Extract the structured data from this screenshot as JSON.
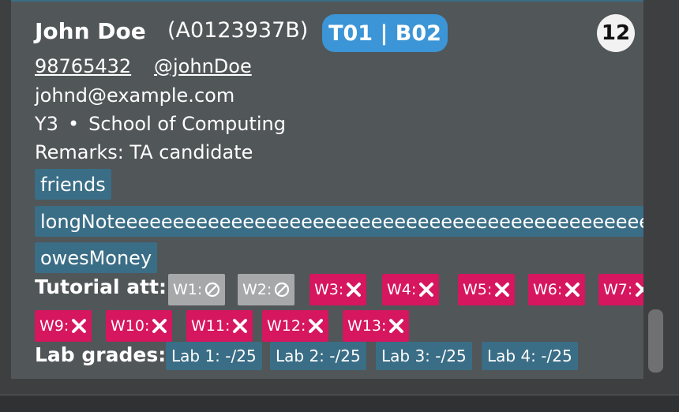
{
  "person": {
    "name": "John Doe",
    "student_id": "(A0123937B)",
    "group": "T01 | B02",
    "index": "12",
    "phone": "98765432",
    "telegram": "@johnDoe",
    "email": "johnd@example.com",
    "year": "Y3",
    "separator": "•",
    "faculty": "School of Computing",
    "remarks": "Remarks: TA candidate"
  },
  "tags": [
    "friends",
    "longNoteeeeeeeeeeeeeeeeeeeeeeeeeeeeeeeeeeeeeeeeeeeeeeeeeeeeeeee",
    "owesMoney"
  ],
  "attendance": {
    "label": "Tutorial att:",
    "weeks": [
      {
        "label": "W1:",
        "status": "not-applicable"
      },
      {
        "label": "W2:",
        "status": "not-applicable"
      },
      {
        "label": "W3:",
        "status": "absent"
      },
      {
        "label": "W4:",
        "status": "absent"
      },
      {
        "label": "W5:",
        "status": "absent"
      },
      {
        "label": "W6:",
        "status": "absent"
      },
      {
        "label": "W7:",
        "status": "absent"
      },
      {
        "label": "W9:",
        "status": "absent"
      },
      {
        "label": "W10:",
        "status": "absent"
      },
      {
        "label": "W11:",
        "status": "absent"
      },
      {
        "label": "W12:",
        "status": "absent"
      },
      {
        "label": "W13:",
        "status": "absent"
      }
    ]
  },
  "labs": {
    "label": "Lab grades:",
    "items": [
      "Lab 1: -/25",
      "Lab 2: -/25",
      "Lab 3: -/25",
      "Lab 4: -/25"
    ]
  },
  "colors": {
    "card_bg": "#515658",
    "group_badge": "#3b95d6",
    "tag_bg": "#3a6d86",
    "absent": "#d6165e",
    "not_applicable": "#a6a8aa"
  },
  "icons": {
    "absent": "cross-icon",
    "not_applicable": "prohibited-icon"
  }
}
